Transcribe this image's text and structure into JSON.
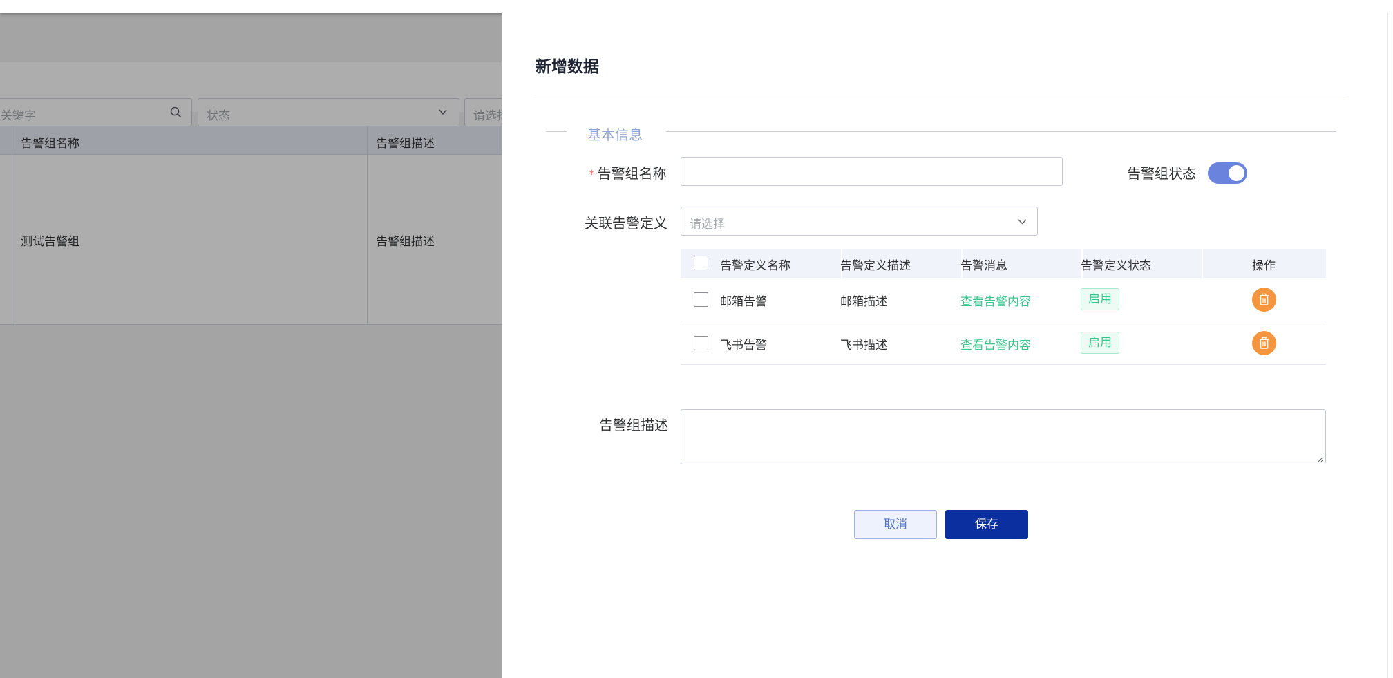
{
  "background": {
    "search": {
      "placeholder": "关键字"
    },
    "status_select": {
      "placeholder": "状态"
    },
    "other_select": {
      "placeholder": "请选择"
    },
    "table": {
      "headers": [
        "告警组名称",
        "告警组描述"
      ],
      "rows": [
        {
          "name": "测试告警组",
          "description": "告警组描述"
        }
      ]
    }
  },
  "drawer": {
    "title": "新增数据",
    "section_title": "基本信息",
    "fields": {
      "name_label": "告警组名称",
      "name_value": "",
      "required_mark": "*",
      "status_label": "告警组状态",
      "status_on": true,
      "definition_label": "关联告警定义",
      "definition_placeholder": "请选择",
      "description_label": "告警组描述",
      "description_value": ""
    },
    "definitions_table": {
      "headers": [
        "告警定义名称",
        "告警定义描述",
        "告警消息",
        "告警定义状态",
        "操作"
      ],
      "rows": [
        {
          "name": "邮箱告警",
          "description": "邮箱描述",
          "message_link": "查看告警内容",
          "status": "启用"
        },
        {
          "name": "飞书告警",
          "description": "飞书描述",
          "message_link": "查看告警内容",
          "status": "启用"
        }
      ]
    },
    "buttons": {
      "cancel": "取消",
      "save": "保存"
    }
  },
  "colors": {
    "primary": "#0b2f9f",
    "switch_on": "#6a83dd",
    "success": "#3ac58d",
    "danger_orange": "#f4953f",
    "section_title": "#8fa3d6"
  }
}
